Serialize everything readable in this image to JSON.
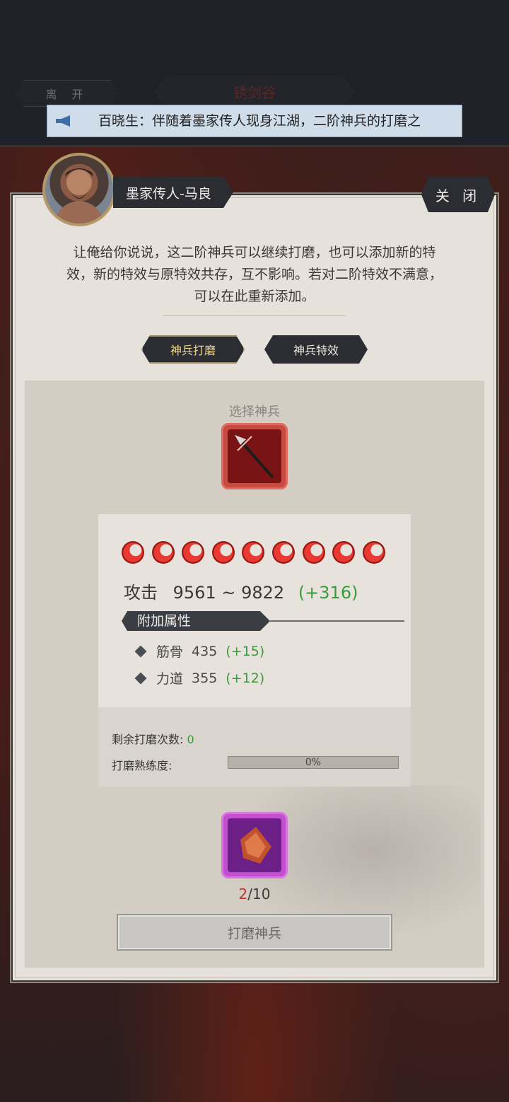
{
  "topbar": {
    "leave_label": "离 开",
    "location_title": "锈剑谷",
    "notice_text": "百晓生：伴随着墨家传人现身江湖，二阶神兵的打磨之"
  },
  "npc": {
    "name": "墨家传人-马良",
    "close_label": "关 闭",
    "dialog_lines": [
      "让俺给你说说，这二阶神兵可以继续打磨，也可以添加新的特",
      "效，新的特效与原特效共存，互不影响。若对二阶特效不满意，",
      "可以在此重新添加。"
    ]
  },
  "tabs": [
    {
      "label": "神兵打磨",
      "active": true
    },
    {
      "label": "神兵特效",
      "active": false
    }
  ],
  "workbench": {
    "select_label": "选择神兵",
    "weapon_icon": "spear-icon",
    "flame_count": 9,
    "attack": {
      "label": "攻击",
      "range": "9561 ~ 9822",
      "bonus": "(+316)"
    },
    "attr_header": "附加属性",
    "attrs": [
      {
        "name": "筋骨",
        "value": "435",
        "bonus": "(+15)"
      },
      {
        "name": "力道",
        "value": "355",
        "bonus": "(+12)"
      }
    ],
    "remaining_label": "剩余打磨次数:",
    "remaining_value": "0",
    "proficiency_label": "打磨熟练度:",
    "proficiency_percent": 0,
    "proficiency_text": "0%",
    "material_icon": "whetstone-icon",
    "material_have": "2",
    "material_need": "/10",
    "polish_button": "打磨神兵"
  },
  "colors": {
    "accent_green": "#3b9a3b",
    "weapon_slot": "#c84a41",
    "material_slot": "#c34fd0"
  }
}
